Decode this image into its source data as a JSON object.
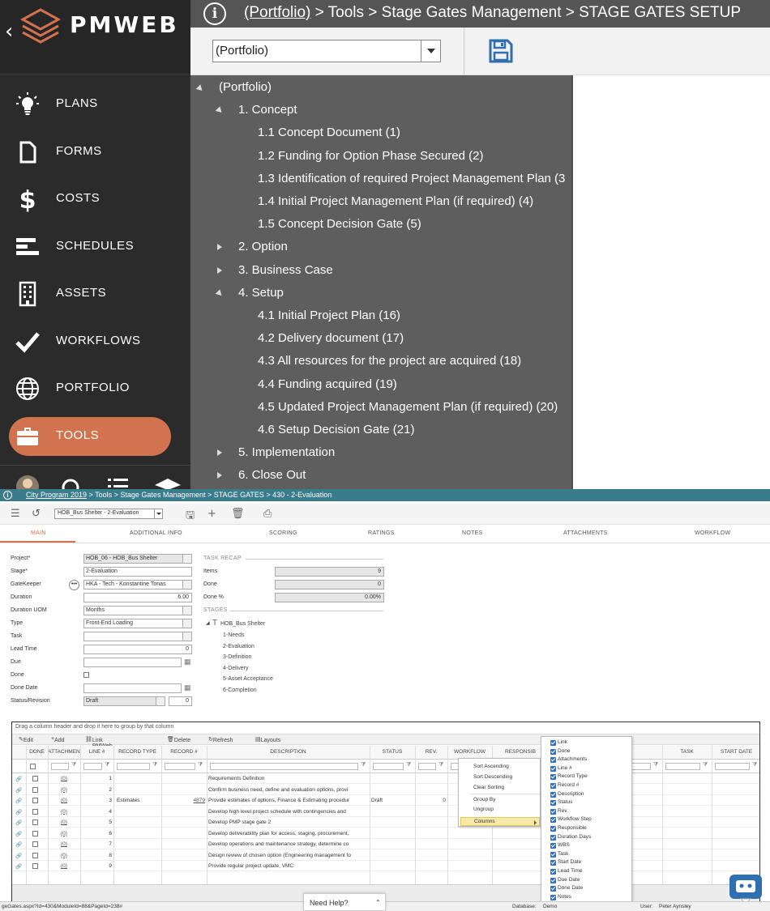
{
  "top": {
    "brand": "PMWEB",
    "nav": [
      {
        "label": "PLANS",
        "icon": "lightbulb-icon"
      },
      {
        "label": "FORMS",
        "icon": "document-icon"
      },
      {
        "label": "COSTS",
        "icon": "dollar-icon"
      },
      {
        "label": "SCHEDULES",
        "icon": "gantt-icon"
      },
      {
        "label": "ASSETS",
        "icon": "building-icon"
      },
      {
        "label": "WORKFLOWS",
        "icon": "checkmark-icon"
      },
      {
        "label": "PORTFOLIO",
        "icon": "globe-icon"
      },
      {
        "label": "TOOLS",
        "icon": "briefcase-icon"
      }
    ],
    "active_nav": "TOOLS",
    "breadcrumb": {
      "link": "(Portfolio)",
      "rest": " > Tools > Stage Gates Management > STAGE GATES SETUP"
    },
    "portfolio_select": "(Portfolio)",
    "tree": {
      "root": "(Portfolio)",
      "items": [
        {
          "label": "1. Concept",
          "level": 1,
          "state": "expanded"
        },
        {
          "label": "1.1 Concept Document (1)",
          "level": 2
        },
        {
          "label": "1.2 Funding for Option Phase Secured (2)",
          "level": 2
        },
        {
          "label": "1.3 Identification of required Project Management Plan (3",
          "level": 2
        },
        {
          "label": "1.4 Initial Project Management Plan (if required) (4)",
          "level": 2
        },
        {
          "label": "1.5 Concept Decision Gate (5)",
          "level": 2
        },
        {
          "label": "2. Option",
          "level": 1,
          "state": "collapsed"
        },
        {
          "label": "3. Business Case",
          "level": 1,
          "state": "collapsed"
        },
        {
          "label": "4. Setup",
          "level": 1,
          "state": "expanded"
        },
        {
          "label": "4.1 Initial Project Plan (16)",
          "level": 2
        },
        {
          "label": "4.2 Delivery document (17)",
          "level": 2
        },
        {
          "label": "4.3 All resources for the project are acquired (18)",
          "level": 2
        },
        {
          "label": "4.4 Funding acquired (19)",
          "level": 2
        },
        {
          "label": "4.5 Updated Project Management Plan (if required) (20)",
          "level": 2
        },
        {
          "label": "4.6 Setup Decision Gate (21)",
          "level": 2
        },
        {
          "label": "5. Implementation",
          "level": 1,
          "state": "collapsed"
        },
        {
          "label": "6. Close Out",
          "level": 1,
          "state": "collapsed"
        }
      ]
    },
    "colors": {
      "accent": "#d2734f",
      "sidebar": "#2b2b2b",
      "tree_bg": "#5e5e5e",
      "topbar": "#555555"
    }
  },
  "bottom": {
    "breadcrumb": {
      "link": "City Program 2019",
      "rest": " > Tools > Stage Gates Management > STAGE GATES > 430 - 2-Evaluation"
    },
    "record_select": "HOB_Bus Shelter  - 2-Evaluation",
    "tabs": [
      "MAIN",
      "ADDITIONAL INFO",
      "SCORING",
      "RATINGS",
      "NOTES",
      "ATTACHMENTS",
      "WORKFLOW"
    ],
    "form": {
      "project_label": "Project*",
      "project_value": "HOB_06 - HOB_Bus Shelter",
      "stage_label": "Stage*",
      "stage_value": "2-Evaluation",
      "gatekeeper_label": "GateKeeper",
      "gatekeeper_value": "HKA - Tech - Konstantine Tonas",
      "duration_label": "Duration",
      "duration_value": "6.00",
      "duration_uom_label": "Duration UOM",
      "duration_uom_value": "Months",
      "type_label": "Type",
      "type_value": "Front-End Loading",
      "task_label": "Task",
      "task_value": "",
      "lead_time_label": "Lead Time",
      "lead_time_value": "0",
      "due_label": "Due",
      "due_value": "",
      "done_label": "Done",
      "done_date_label": "Done Date",
      "done_date_value": "",
      "status_label": "Status/Revision",
      "status_value": "Draft",
      "revision_value": "0"
    },
    "task_recap": {
      "title": "TASK RECAP",
      "items_label": "Items",
      "items_value": "9",
      "done_label": "Done",
      "done_value": "0",
      "done_pct_label": "Done %",
      "done_pct_value": "0.00%"
    },
    "stages": {
      "title": "STAGES",
      "root": "HOB_Bus Shelter",
      "list": [
        "1-Needs",
        "2-Evaluation",
        "3-Definition",
        "4-Delivery",
        "5-Asset Acceptance",
        "6-Completion"
      ]
    },
    "grid": {
      "drag_hint": "Drag a column header and drop it here to group by that column",
      "toolbar": {
        "edit": "Edit",
        "add": "Add",
        "link": "Link PMWeb Record(s)",
        "delete": "Delete",
        "refresh": "Refresh",
        "layouts": "Layouts"
      },
      "columns": [
        "DONE",
        "ATTACHMEN",
        "LINE #",
        "RECORD TYPE",
        "RECORD #",
        "DESCRIPTION",
        "STATUS",
        "REV.",
        "WORKFLOW",
        "RESPONSIB",
        "S",
        "TASK",
        "START DATE"
      ],
      "rows": [
        {
          "att": "(0)",
          "line": "1",
          "type": "",
          "rec": "",
          "desc": "Requirements Definition",
          "status": "",
          "rev": ""
        },
        {
          "att": "(0)",
          "line": "2",
          "type": "",
          "rec": "",
          "desc": "Confirm business need, define and evaluation options, provi",
          "status": "",
          "rev": ""
        },
        {
          "att": "(0)",
          "line": "3",
          "type": "Estimates",
          "rec": "4879",
          "desc": "Provide estimates of options, Finance & Estimating procedur",
          "status": "Draft",
          "rev": "0"
        },
        {
          "att": "(0)",
          "line": "4",
          "type": "",
          "rec": "",
          "desc": "Develop high level project schedule with contingencies and",
          "status": "",
          "rev": ""
        },
        {
          "att": "(0)",
          "line": "5",
          "type": "",
          "rec": "",
          "desc": "Develop PMP stage gate 2",
          "status": "",
          "rev": ""
        },
        {
          "att": "(0)",
          "line": "6",
          "type": "",
          "rec": "",
          "desc": "Develop deliverability plan for access, staging, procurement,",
          "status": "",
          "rev": ""
        },
        {
          "att": "(0)",
          "line": "7",
          "type": "",
          "rec": "",
          "desc": "Develop operations and maintenance strategy, determine co",
          "status": "",
          "rev": ""
        },
        {
          "att": "(0)",
          "line": "8",
          "type": "",
          "rec": "",
          "desc": "Design review of chosen option (Engineering management fo",
          "status": "",
          "rev": ""
        },
        {
          "att": "(0)",
          "line": "9",
          "type": "",
          "rec": "",
          "desc": "Provide regular project update, VMC",
          "status": "",
          "rev": ""
        }
      ]
    },
    "context_menu": [
      "Sort Ascending",
      "Sort Descending",
      "Clear Sorting",
      "Group By",
      "Ungroup",
      "Columns"
    ],
    "columns_menu": [
      "Link",
      "Done",
      "Attachments",
      "Line #",
      "Record Type",
      "Record #",
      "Description",
      "Status",
      "Rev.",
      "Workflow Step",
      "Responsible",
      "Duration Days",
      "WBS",
      "Task",
      "Start Date",
      "Lead Time",
      "Due Date",
      "Done Date",
      "Notes"
    ],
    "status_bar": {
      "url": "geGates.aspx?Id=430&ModuleId=88&PageId=238#",
      "database_label": "Database:",
      "database_value": "Demo",
      "user_label": "User:",
      "user_value": "Peter Aynsley"
    },
    "need_help": "Need Help?"
  }
}
